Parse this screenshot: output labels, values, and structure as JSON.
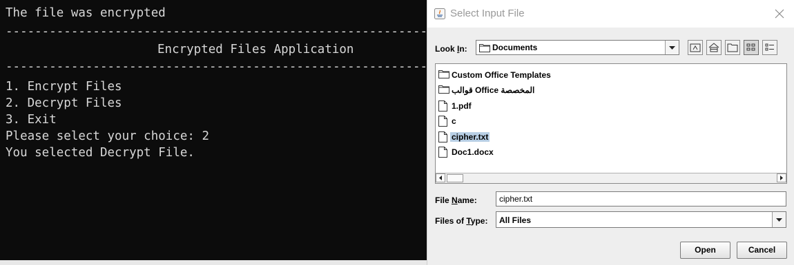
{
  "console": {
    "status_line": "The file was encrypted",
    "separator": "--------------------------------------------------------------------",
    "app_title": "Encrypted Files Application",
    "menu": [
      "1. Encrypt Files",
      "2. Decrypt Files",
      "3. Exit"
    ],
    "prompt": "Please select your choice: 2",
    "result": "You selected Decrypt File."
  },
  "dialog": {
    "title": "Select Input File",
    "look_in_label_pre": "Look ",
    "look_in_label_mn": "I",
    "look_in_label_post": "n:",
    "look_in_value": "Documents",
    "files": [
      {
        "name": "Custom Office Templates",
        "icon": "folder-icon",
        "selected": false
      },
      {
        "name": "قوالب Office المخصصة",
        "icon": "folder-icon",
        "selected": false
      },
      {
        "name": "1.pdf",
        "icon": "file-icon",
        "selected": false
      },
      {
        "name": "c",
        "icon": "file-icon",
        "selected": false
      },
      {
        "name": "cipher.txt",
        "icon": "file-icon",
        "selected": true
      },
      {
        "name": "Doc1.docx",
        "icon": "file-icon",
        "selected": false
      }
    ],
    "file_name_label_pre": "File ",
    "file_name_label_mn": "N",
    "file_name_label_post": "ame:",
    "file_name_value": "cipher.txt",
    "file_type_label_pre": "Files of ",
    "file_type_label_mn": "T",
    "file_type_label_post": "ype:",
    "file_type_value": "All Files",
    "open_label": "Open",
    "cancel_label": "Cancel"
  },
  "colors": {
    "console_bg": "#0c0c0c",
    "console_fg": "#d8d8d8",
    "selection": "#b8cfe5"
  }
}
